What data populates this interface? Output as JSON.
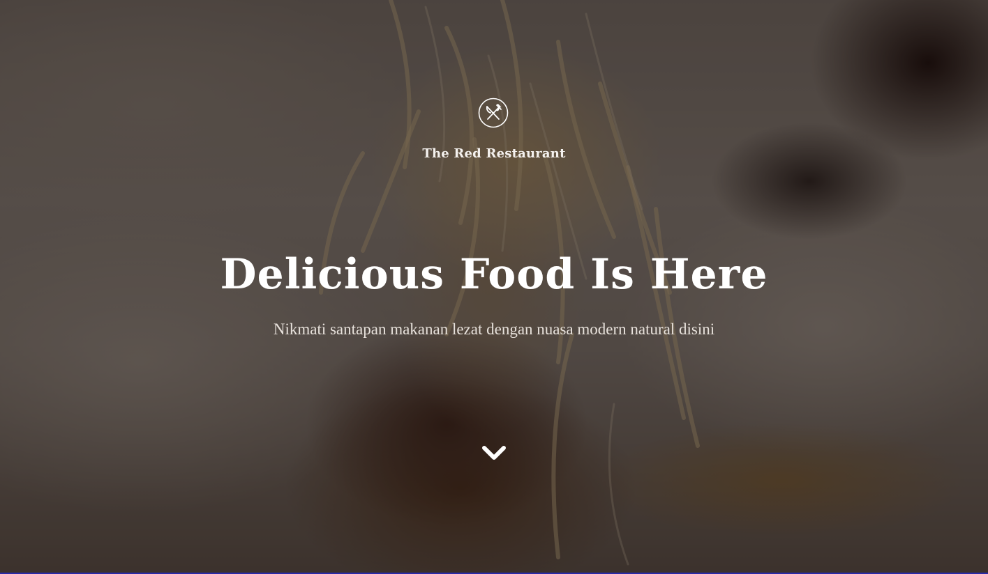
{
  "brand": {
    "name": "The Red Restaurant",
    "icon": "fork-knife-icon"
  },
  "hero": {
    "headline": "Delicious Food Is Here",
    "tagline": "Nikmati santapan makanan lezat dengan nuasa modern natural disini",
    "scroll_icon": "chevron-down-icon"
  },
  "colors": {
    "text": "#ffffff",
    "overlay": "#140c0a",
    "bottom_border": "#2a2aa8"
  }
}
